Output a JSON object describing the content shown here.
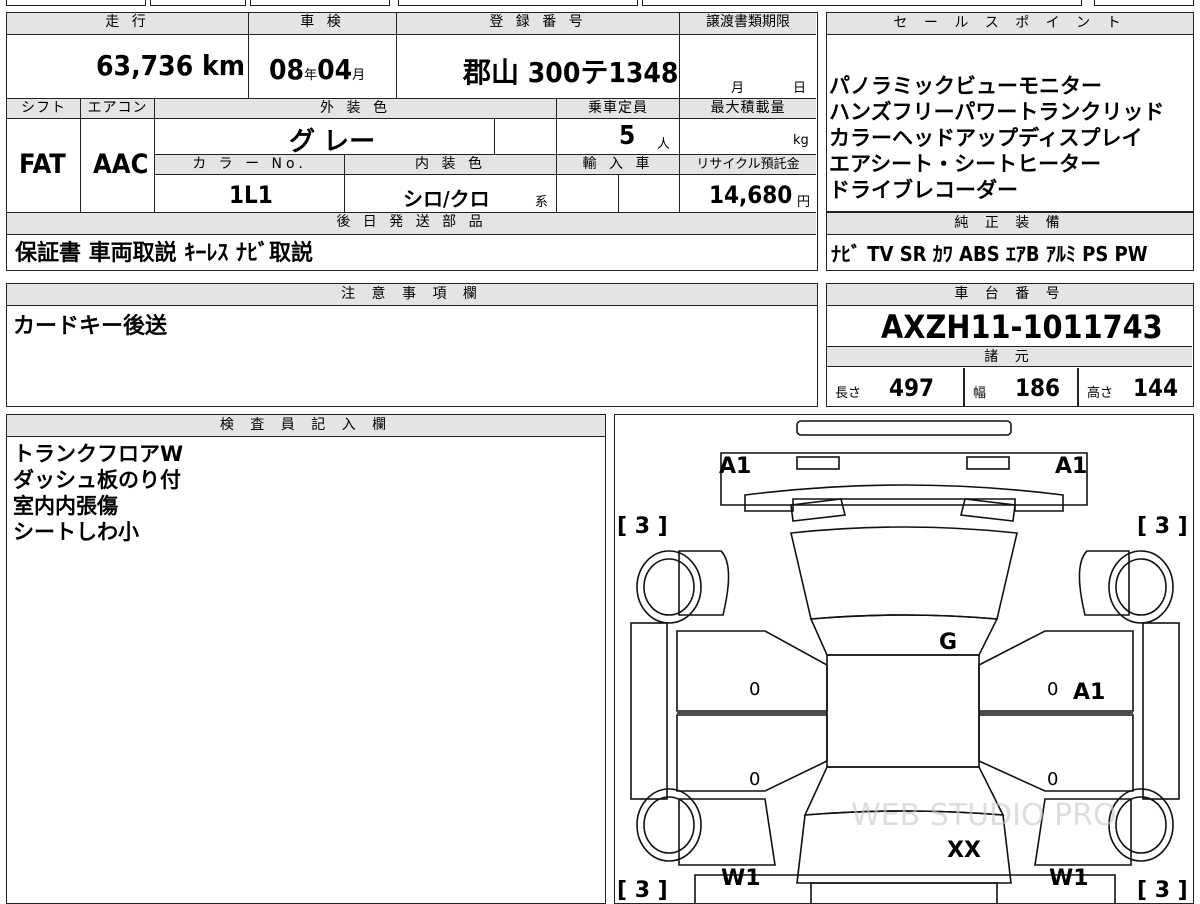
{
  "spec": {
    "mileage_label": "走 行",
    "mileage": "63,736 km",
    "inspection_label": "車 検",
    "inspection_year": "08",
    "inspection_year_unit": "年",
    "inspection_month": "04",
    "inspection_month_unit": "月",
    "registration_label": "登 録 番 号",
    "registration": "郡山 300テ1348",
    "transfer_deadline_label": "譲渡書類期限",
    "transfer_month": "月",
    "transfer_day": "日",
    "shift_label": "シフト",
    "shift": "FAT",
    "aircon_label": "エアコン",
    "aircon": "AAC",
    "exterior_color_label": "外 装 色",
    "exterior_color": "グ レー",
    "capacity_label": "乗車定員",
    "capacity": "5",
    "capacity_unit": "人",
    "max_load_label": "最大積載量",
    "max_load_unit": "kg",
    "color_no_label": "カ ラ ー No.",
    "color_no": "1L1",
    "interior_color_label": "内 装 色",
    "interior_color": "シロ/クロ",
    "interior_color_suffix": "系",
    "import_label": "輸 入 車",
    "recycle_label": "リサイクル預託金",
    "recycle_fee": "14,680",
    "recycle_unit": "円",
    "later_parts_label": "後 日 発 送 部 品",
    "later_parts": "保証書 車両取説 ｷｰﾚｽ ﾅﾋﾞ取説"
  },
  "sales_points": {
    "label": "セ ー ル ス ポ イ ン ト",
    "items": [
      "パノラミックビューモニター",
      "ハンズフリーパワートランクリッド",
      "カラーヘッドアップディスプレイ",
      "エアシート・シートヒーター",
      "ドライブレコーダー"
    ]
  },
  "genuine_equipment": {
    "label": "純 正 装 備",
    "items": "ﾅﾋﾞ TV SR ｶﾜ ABS ｴｱB ｱﾙﾐ PS PW"
  },
  "notes": {
    "label": "注 意 事 項 欄",
    "text": "カードキー後送"
  },
  "chassis": {
    "label": "車 台 番 号",
    "number": "AXZH11-1011743",
    "dims_label": "諸 元",
    "length_label": "長さ",
    "length": "497",
    "width_label": "幅",
    "width": "186",
    "height_label": "高さ",
    "height": "144"
  },
  "inspector": {
    "label": "検 査 員 記 入 欄",
    "lines": [
      "トランクフロアW",
      "ダッシュ板のり付",
      "室内内張傷",
      "シートしわ小"
    ]
  },
  "diagram": {
    "marks": {
      "front_left": "A1",
      "front_right": "A1",
      "tire_fl": "[ 3 ]",
      "tire_fr": "[ 3 ]",
      "tire_rl": "[ 3 ]",
      "tire_rr": "[ 3 ]",
      "roof": "G",
      "door_fl": "0",
      "door_rl": "0",
      "door_fr": "0",
      "door_fr_mark": "A1",
      "door_rr": "0",
      "trunk": "XX",
      "rear_left": "W1",
      "rear_right": "W1"
    },
    "watermark": "WEB STUDIO PRO"
  }
}
